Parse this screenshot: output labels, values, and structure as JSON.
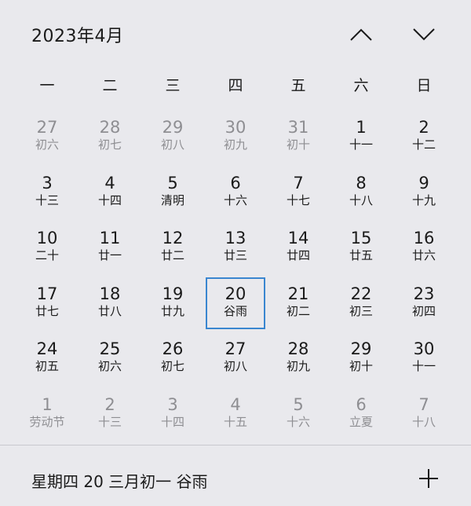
{
  "header": {
    "title": "2023年4月",
    "prev_icon": "chevron-up-icon",
    "next_icon": "chevron-down-icon"
  },
  "weekdays": [
    "一",
    "二",
    "三",
    "四",
    "五",
    "六",
    "日"
  ],
  "days": [
    {
      "num": "27",
      "lunar": "初六",
      "other": true
    },
    {
      "num": "28",
      "lunar": "初七",
      "other": true
    },
    {
      "num": "29",
      "lunar": "初八",
      "other": true
    },
    {
      "num": "30",
      "lunar": "初九",
      "other": true
    },
    {
      "num": "31",
      "lunar": "初十",
      "other": true
    },
    {
      "num": "1",
      "lunar": "十一",
      "other": false
    },
    {
      "num": "2",
      "lunar": "十二",
      "other": false
    },
    {
      "num": "3",
      "lunar": "十三",
      "other": false
    },
    {
      "num": "4",
      "lunar": "十四",
      "other": false
    },
    {
      "num": "5",
      "lunar": "清明",
      "other": false
    },
    {
      "num": "6",
      "lunar": "十六",
      "other": false
    },
    {
      "num": "7",
      "lunar": "十七",
      "other": false
    },
    {
      "num": "8",
      "lunar": "十八",
      "other": false
    },
    {
      "num": "9",
      "lunar": "十九",
      "other": false
    },
    {
      "num": "10",
      "lunar": "二十",
      "other": false
    },
    {
      "num": "11",
      "lunar": "廿一",
      "other": false
    },
    {
      "num": "12",
      "lunar": "廿二",
      "other": false
    },
    {
      "num": "13",
      "lunar": "廿三",
      "other": false
    },
    {
      "num": "14",
      "lunar": "廿四",
      "other": false
    },
    {
      "num": "15",
      "lunar": "廿五",
      "other": false
    },
    {
      "num": "16",
      "lunar": "廿六",
      "other": false
    },
    {
      "num": "17",
      "lunar": "廿七",
      "other": false
    },
    {
      "num": "18",
      "lunar": "廿八",
      "other": false
    },
    {
      "num": "19",
      "lunar": "廿九",
      "other": false
    },
    {
      "num": "20",
      "lunar": "谷雨",
      "other": false,
      "selected": true
    },
    {
      "num": "21",
      "lunar": "初二",
      "other": false
    },
    {
      "num": "22",
      "lunar": "初三",
      "other": false
    },
    {
      "num": "23",
      "lunar": "初四",
      "other": false
    },
    {
      "num": "24",
      "lunar": "初五",
      "other": false
    },
    {
      "num": "25",
      "lunar": "初六",
      "other": false
    },
    {
      "num": "26",
      "lunar": "初七",
      "other": false
    },
    {
      "num": "27",
      "lunar": "初八",
      "other": false
    },
    {
      "num": "28",
      "lunar": "初九",
      "other": false
    },
    {
      "num": "29",
      "lunar": "初十",
      "other": false
    },
    {
      "num": "30",
      "lunar": "十一",
      "other": false
    },
    {
      "num": "1",
      "lunar": "劳动节",
      "other": true
    },
    {
      "num": "2",
      "lunar": "十三",
      "other": true
    },
    {
      "num": "3",
      "lunar": "十四",
      "other": true
    },
    {
      "num": "4",
      "lunar": "十五",
      "other": true
    },
    {
      "num": "5",
      "lunar": "十六",
      "other": true
    },
    {
      "num": "6",
      "lunar": "立夏",
      "other": true
    },
    {
      "num": "7",
      "lunar": "十八",
      "other": true
    }
  ],
  "footer": {
    "text": "星期四 20 三月初一 谷雨",
    "add_icon": "plus-icon"
  },
  "colors": {
    "background": "#e9e9ed",
    "selected_border": "#3a86d0",
    "muted_text": "#8e8e92"
  }
}
